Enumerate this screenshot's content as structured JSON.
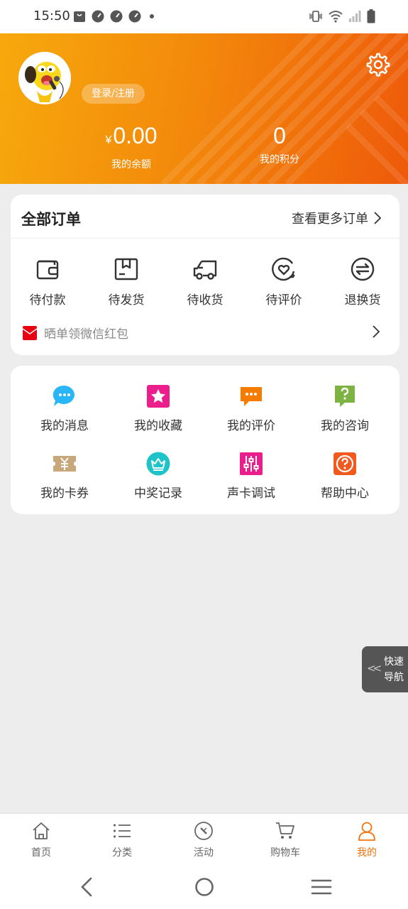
{
  "status_bar": {
    "time": "15:50"
  },
  "header": {
    "login_label": "登录/注册",
    "balance": {
      "currency": "¥",
      "value": "0.00",
      "label": "我的余额"
    },
    "points": {
      "value": "0",
      "label": "我的积分"
    }
  },
  "orders": {
    "title": "全部订单",
    "more_label": "查看更多订单",
    "items": [
      {
        "label": "待付款",
        "icon": "wallet-icon"
      },
      {
        "label": "待发货",
        "icon": "package-icon"
      },
      {
        "label": "待收货",
        "icon": "truck-icon"
      },
      {
        "label": "待评价",
        "icon": "heart-review-icon"
      },
      {
        "label": "退换货",
        "icon": "exchange-icon"
      }
    ],
    "promo_label": "晒单领微信红包"
  },
  "services": {
    "items": [
      {
        "label": "我的消息",
        "icon": "chat-bubble-icon",
        "color": "#29b6f6"
      },
      {
        "label": "我的收藏",
        "icon": "star-icon",
        "color": "#ec1e8c"
      },
      {
        "label": "我的评价",
        "icon": "comment-icon",
        "color": "#f57c00"
      },
      {
        "label": "我的咨询",
        "icon": "question-bubble-icon",
        "color": "#7cb342"
      },
      {
        "label": "我的卡券",
        "icon": "coupon-icon",
        "color": "#c8a77a"
      },
      {
        "label": "中奖记录",
        "icon": "crown-icon",
        "color": "#1ec3c8"
      },
      {
        "label": "声卡调试",
        "icon": "equalizer-icon",
        "color": "#e91e8c"
      },
      {
        "label": "帮助中心",
        "icon": "help-icon",
        "color": "#f05a1e"
      }
    ]
  },
  "quick_nav": {
    "line1": "快速",
    "line2": "导航"
  },
  "bottom_nav": {
    "tabs": [
      {
        "label": "首页",
        "icon": "home-icon"
      },
      {
        "label": "分类",
        "icon": "list-icon"
      },
      {
        "label": "活动",
        "icon": "compass-icon"
      },
      {
        "label": "购物车",
        "icon": "cart-icon"
      },
      {
        "label": "我的",
        "icon": "user-icon",
        "active": true
      }
    ]
  },
  "theme": {
    "accent": "#f2720c",
    "header_start": "#f7a90c",
    "header_end": "#ee5a0a"
  }
}
